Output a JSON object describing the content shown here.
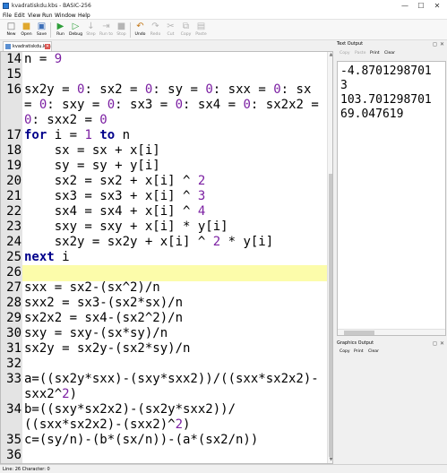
{
  "window": {
    "title": "kvadratiskdu.kbs - BASIC-256",
    "minimize": "—",
    "maximize": "☐",
    "close": "✕"
  },
  "menu": [
    "File",
    "Edit",
    "View",
    "Run",
    "Window",
    "Help"
  ],
  "toolbar": {
    "new": "New",
    "open": "Open",
    "save": "Save",
    "run": "Run",
    "debug": "Debug",
    "step": "Step",
    "run_to": "Run to",
    "stop": "Stop",
    "undo": "Undo",
    "redo": "Redo",
    "cut": "Cut",
    "copy": "Copy",
    "paste": "Paste"
  },
  "editor": {
    "tab_label": "kvadratiskdu.kbs",
    "current_line": "26",
    "lines": [
      {
        "n": "14",
        "text": "n = 9"
      },
      {
        "n": "15",
        "text": ""
      },
      {
        "n": "16",
        "text": "sx2y = 0: sx2 = 0: sy = 0: sxx = 0: sx"
      },
      {
        "n": "",
        "text": "= 0: sxy = 0: sx3 = 0: sx4 = 0: sx2x2 ="
      },
      {
        "n": "",
        "text": "0: sxx2 = 0"
      },
      {
        "n": "17",
        "text": "for i = 1 to n"
      },
      {
        "n": "18",
        "text": "    sx = sx + x[i]"
      },
      {
        "n": "19",
        "text": "    sy = sy + y[i]"
      },
      {
        "n": "20",
        "text": "    sx2 = sx2 + x[i] ^ 2"
      },
      {
        "n": "21",
        "text": "    sx3 = sx3 + x[i] ^ 3"
      },
      {
        "n": "22",
        "text": "    sx4 = sx4 + x[i] ^ 4"
      },
      {
        "n": "23",
        "text": "    sxy = sxy + x[i] * y[i]"
      },
      {
        "n": "24",
        "text": "    sx2y = sx2y + x[i] ^ 2 * y[i]"
      },
      {
        "n": "25",
        "text": "next i"
      },
      {
        "n": "26",
        "text": ""
      },
      {
        "n": "27",
        "text": "sxx = sx2-(sx^2)/n"
      },
      {
        "n": "28",
        "text": "sxx2 = sx3-(sx2*sx)/n"
      },
      {
        "n": "29",
        "text": "sx2x2 = sx4-(sx2^2)/n"
      },
      {
        "n": "30",
        "text": "sxy = sxy-(sx*sy)/n"
      },
      {
        "n": "31",
        "text": "sx2y = sx2y-(sx2*sy)/n"
      },
      {
        "n": "32",
        "text": ""
      },
      {
        "n": "33",
        "text": "a=((sx2y*sxx)-(sxy*sxx2))/((sxx*sx2x2)-"
      },
      {
        "n": "",
        "text": "sxx2^2)"
      },
      {
        "n": "34",
        "text": "b=((sxy*sx2x2)-(sx2y*sxx2))/"
      },
      {
        "n": "",
        "text": "((sxx*sx2x2)-(sxx2)^2)"
      },
      {
        "n": "35",
        "text": "c=(sy/n)-(b*(sx/n))-(a*(sx2/n))"
      },
      {
        "n": "36",
        "text": ""
      }
    ]
  },
  "text_output": {
    "title": "Text Output",
    "toolbar": {
      "copy": "Copy",
      "paste": "Paste",
      "print": "Print",
      "clear": "Clear"
    },
    "lines": [
      "-4.8701298701",
      "3",
      "103.701298701",
      "69.047619"
    ]
  },
  "graphics_output": {
    "title": "Graphics Output",
    "toolbar": {
      "copy": "Copy",
      "print": "Print",
      "clear": "Clear"
    }
  },
  "status": "Line: 26 Character: 0",
  "icons": {
    "dock_float": "float-icon",
    "dock_close": "close-icon"
  }
}
